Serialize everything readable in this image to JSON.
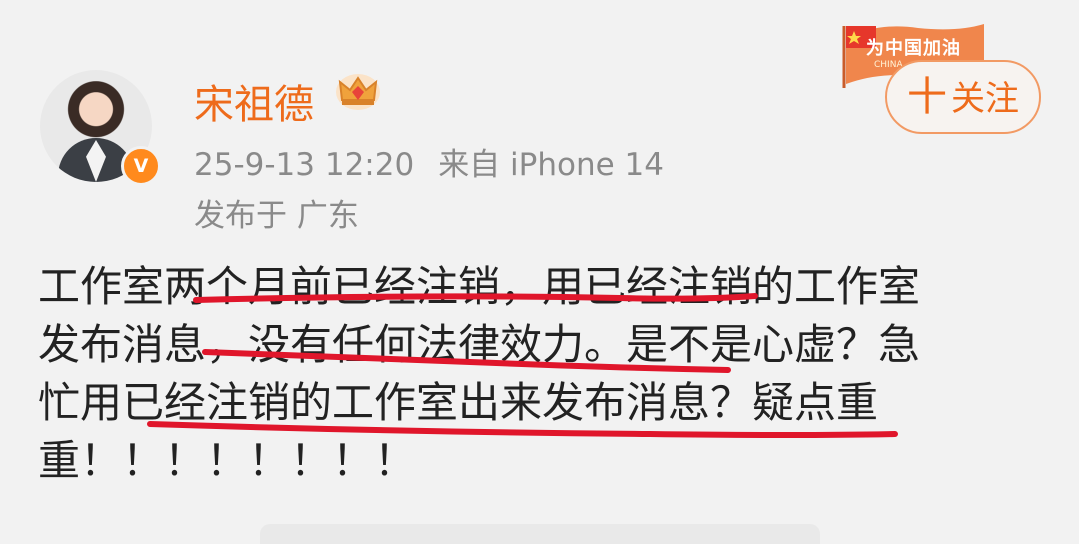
{
  "post": {
    "author": "宋祖德",
    "verified_mark": "V",
    "timestamp": "25-9-13 12:20",
    "source": "来自 iPhone 14",
    "location": "发布于 广东",
    "follow_label": "关注",
    "follow_plus": "十",
    "badge_text": "为中国加油",
    "badge_subtext": "CHINA",
    "content_lines": [
      "工作室两个月前已经注销，用已经注销的工作室",
      "发布消息，没有任何法律效力。是不是心虚？急",
      "忙用已经注销的工作室出来发布消息？疑点重",
      "重！！！！！！！！"
    ]
  },
  "colors": {
    "accent": "#ee6b1b",
    "underline": "#e0162b",
    "badge": "#ff8a1d"
  },
  "icons": {
    "crown": "crown-icon",
    "verified": "verified-badge-icon",
    "flag": "china-flag-icon"
  }
}
